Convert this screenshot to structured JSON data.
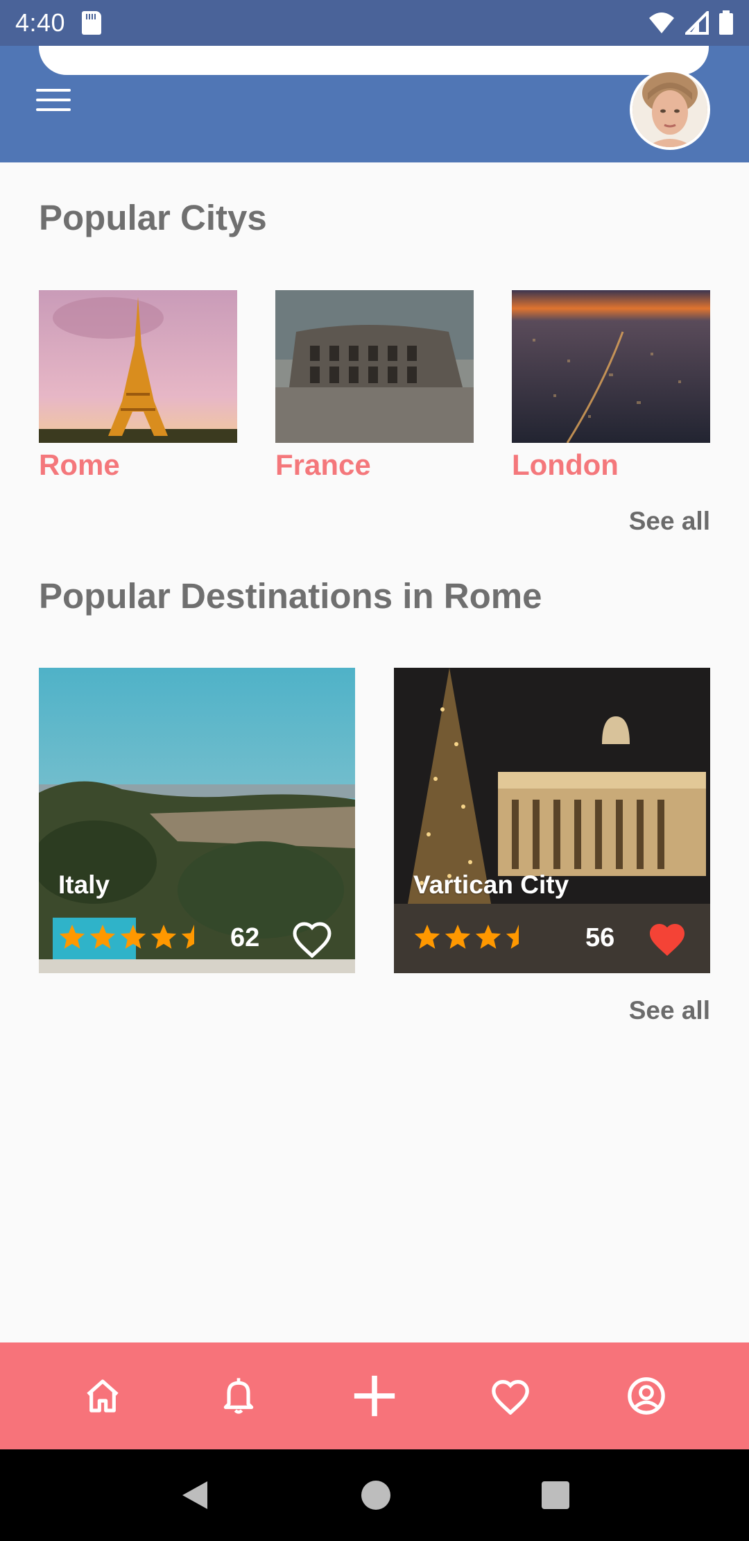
{
  "status_bar": {
    "time": "4:40"
  },
  "popular_cities": {
    "title": "Popular Citys",
    "items": [
      {
        "name": "Rome"
      },
      {
        "name": "France"
      },
      {
        "name": "London"
      }
    ],
    "see_all": "See all"
  },
  "destinations": {
    "title": "Popular Destinations in Rome",
    "items": [
      {
        "name": "Italy",
        "rating": 4.5,
        "count": "62",
        "favorite": false
      },
      {
        "name": "Vartican City",
        "rating": 3.5,
        "count": "56",
        "favorite": true
      }
    ],
    "see_all": "See all"
  },
  "bottom_nav": {
    "items": [
      "home-icon",
      "bell-icon",
      "add-icon",
      "heart-icon",
      "profile-icon"
    ]
  },
  "colors": {
    "app_bar": "#5076b5",
    "status_bar": "#4a6399",
    "accent": "#f7737a",
    "city_label": "#f4777b",
    "star": "#ff9800",
    "favorite": "#f44336"
  }
}
